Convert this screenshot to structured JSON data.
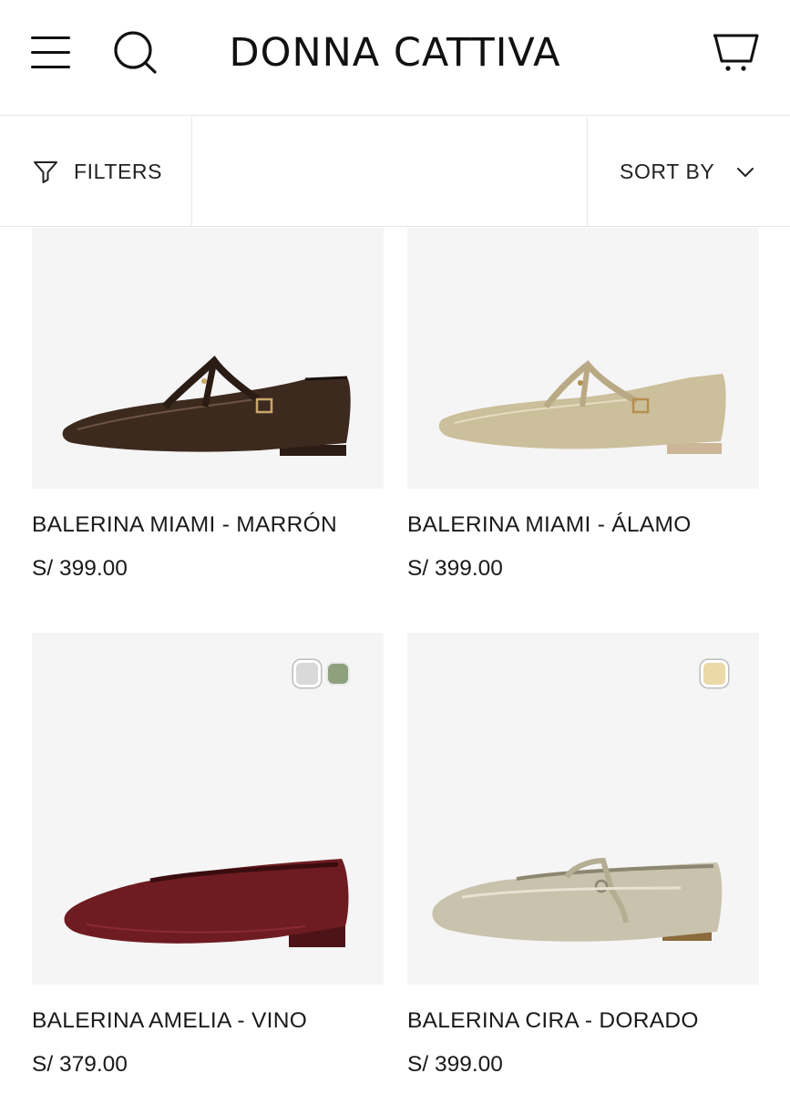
{
  "header": {
    "brand": "DONNA CATTIVA",
    "menu_icon": "hamburger-menu-icon",
    "search_icon": "search-icon",
    "cart_icon": "cart-icon"
  },
  "toolbar": {
    "filters_label": "FILTERS",
    "sort_label": "SORT BY",
    "filter_icon": "funnel-icon",
    "sort_icon": "chevron-down-icon"
  },
  "products": [
    {
      "name": "BALERINA MIAMI - MARRÓN",
      "price": "S/ 399.00",
      "swatches": []
    },
    {
      "name": "BALERINA MIAMI - ÁLAMO",
      "price": "S/ 399.00",
      "swatches": []
    },
    {
      "name": "BALERINA AMELIA - VINO",
      "price": "S/ 379.00",
      "swatches": [
        "#d9d9d9",
        "#8fa07f"
      ]
    },
    {
      "name": "BALERINA CIRA - DORADO",
      "price": "S/ 399.00",
      "swatches": [
        "#ecd9a8"
      ]
    }
  ],
  "colors": {
    "text": "#111111",
    "divider": "#e6e6e6",
    "image_bg": "#f5f5f5"
  }
}
